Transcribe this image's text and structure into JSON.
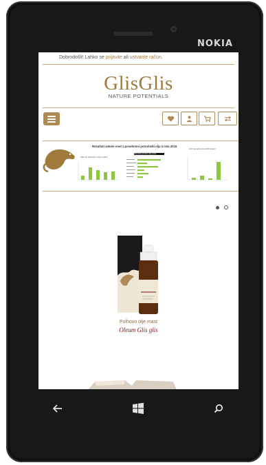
{
  "device": {
    "brand": "NOKIA"
  },
  "header": {
    "welcome_prefix": "Dobrodošli! Lahko se ",
    "login_link": "prijavite",
    "middle": " ali ",
    "register_link": "ustvarite račun",
    "suffix": "."
  },
  "logo": {
    "title": "GlisGlis",
    "subtitle": "NATURE POTENTIALS"
  },
  "toolbar": {
    "menu_icon": "hamburger-icon",
    "icons": [
      "heart-icon",
      "user-icon",
      "cart-icon",
      "compare-icon"
    ]
  },
  "banner": {
    "title": "Rezultati ankete med 1.posebnimi potrošniki olja iz leta 2015",
    "chart1_title": "Kako ste zadovoljni z oljem polha?",
    "chart2_title": "Rezultati uporabe olja polha",
    "chart3_title": "Ali bi olje polha priporočili drugim?"
  },
  "slider": {
    "slides": 2,
    "active": 2
  },
  "product": {
    "line1": "Polhovo olje mast",
    "line2": "Oleum Glis glis"
  },
  "colors": {
    "accent": "#b08a55",
    "dark_red": "#7a1010",
    "green": "#8dc63f"
  }
}
